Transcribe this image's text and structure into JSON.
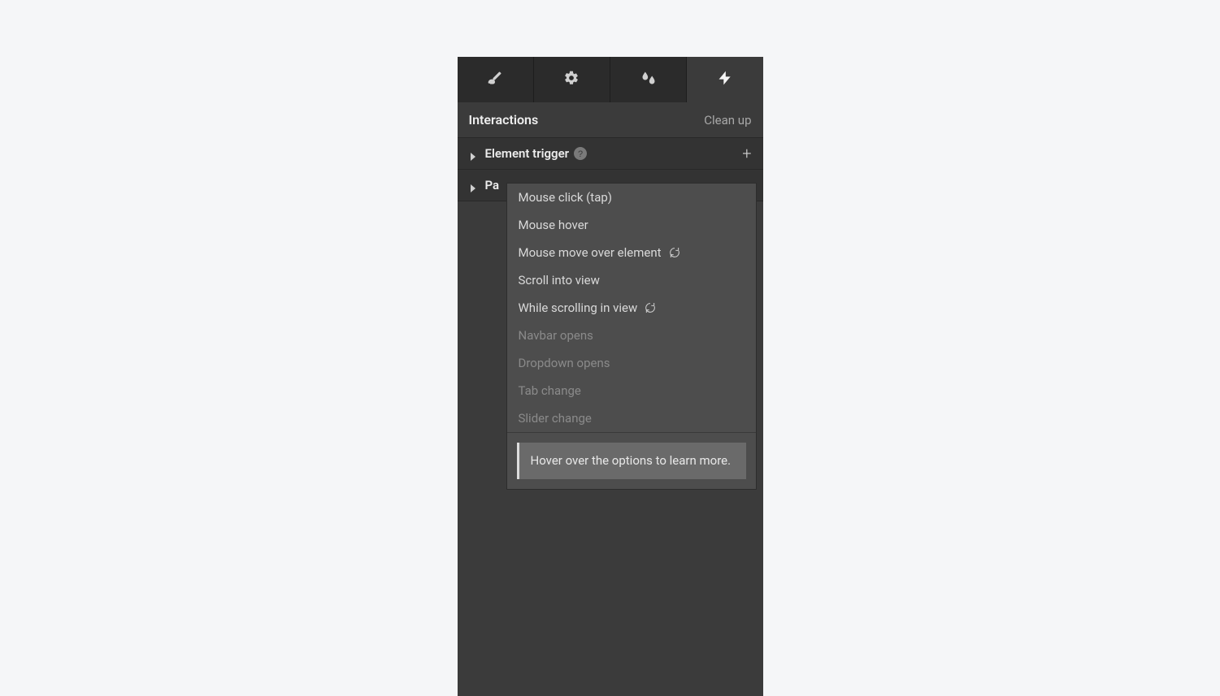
{
  "header": {
    "title": "Interactions",
    "cleanup": "Clean up"
  },
  "rows": {
    "element_trigger": "Element trigger",
    "page_row_visible_prefix": "Pa"
  },
  "dropdown": {
    "items": [
      {
        "label": "Mouse click (tap)",
        "disabled": false,
        "icon": null
      },
      {
        "label": "Mouse hover",
        "disabled": false,
        "icon": null
      },
      {
        "label": "Mouse move over element",
        "disabled": false,
        "icon": "refresh"
      },
      {
        "label": "Scroll into view",
        "disabled": false,
        "icon": null
      },
      {
        "label": "While scrolling in view",
        "disabled": false,
        "icon": "refresh"
      },
      {
        "label": "Navbar opens",
        "disabled": true,
        "icon": null
      },
      {
        "label": "Dropdown opens",
        "disabled": true,
        "icon": null
      },
      {
        "label": "Tab change",
        "disabled": true,
        "icon": null
      },
      {
        "label": "Slider change",
        "disabled": true,
        "icon": null
      }
    ],
    "hint": "Hover over the options to learn more."
  }
}
